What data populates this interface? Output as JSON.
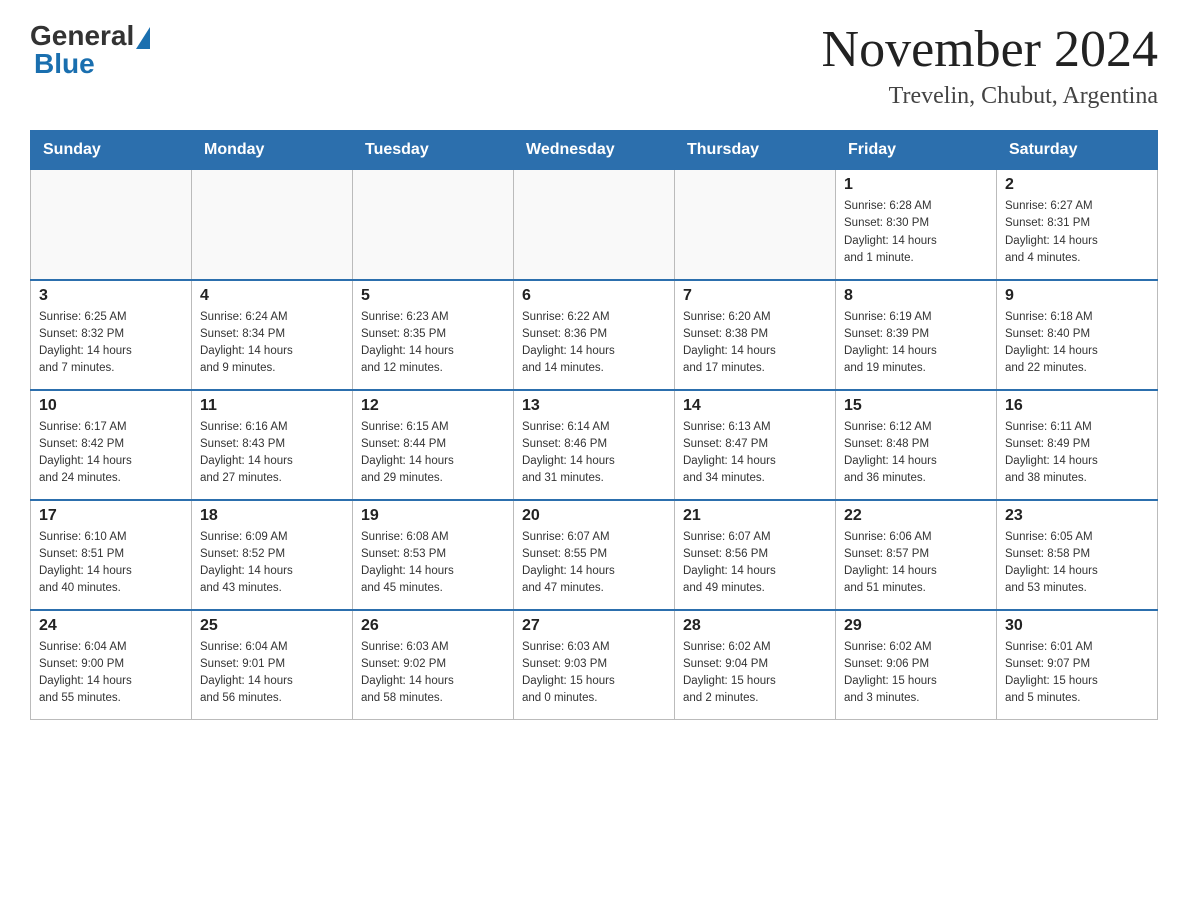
{
  "header": {
    "logo_general": "General",
    "logo_blue": "Blue",
    "month_title": "November 2024",
    "location": "Trevelin, Chubut, Argentina"
  },
  "days_of_week": [
    "Sunday",
    "Monday",
    "Tuesday",
    "Wednesday",
    "Thursday",
    "Friday",
    "Saturday"
  ],
  "weeks": [
    [
      {
        "day": "",
        "info": ""
      },
      {
        "day": "",
        "info": ""
      },
      {
        "day": "",
        "info": ""
      },
      {
        "day": "",
        "info": ""
      },
      {
        "day": "",
        "info": ""
      },
      {
        "day": "1",
        "info": "Sunrise: 6:28 AM\nSunset: 8:30 PM\nDaylight: 14 hours\nand 1 minute."
      },
      {
        "day": "2",
        "info": "Sunrise: 6:27 AM\nSunset: 8:31 PM\nDaylight: 14 hours\nand 4 minutes."
      }
    ],
    [
      {
        "day": "3",
        "info": "Sunrise: 6:25 AM\nSunset: 8:32 PM\nDaylight: 14 hours\nand 7 minutes."
      },
      {
        "day": "4",
        "info": "Sunrise: 6:24 AM\nSunset: 8:34 PM\nDaylight: 14 hours\nand 9 minutes."
      },
      {
        "day": "5",
        "info": "Sunrise: 6:23 AM\nSunset: 8:35 PM\nDaylight: 14 hours\nand 12 minutes."
      },
      {
        "day": "6",
        "info": "Sunrise: 6:22 AM\nSunset: 8:36 PM\nDaylight: 14 hours\nand 14 minutes."
      },
      {
        "day": "7",
        "info": "Sunrise: 6:20 AM\nSunset: 8:38 PM\nDaylight: 14 hours\nand 17 minutes."
      },
      {
        "day": "8",
        "info": "Sunrise: 6:19 AM\nSunset: 8:39 PM\nDaylight: 14 hours\nand 19 minutes."
      },
      {
        "day": "9",
        "info": "Sunrise: 6:18 AM\nSunset: 8:40 PM\nDaylight: 14 hours\nand 22 minutes."
      }
    ],
    [
      {
        "day": "10",
        "info": "Sunrise: 6:17 AM\nSunset: 8:42 PM\nDaylight: 14 hours\nand 24 minutes."
      },
      {
        "day": "11",
        "info": "Sunrise: 6:16 AM\nSunset: 8:43 PM\nDaylight: 14 hours\nand 27 minutes."
      },
      {
        "day": "12",
        "info": "Sunrise: 6:15 AM\nSunset: 8:44 PM\nDaylight: 14 hours\nand 29 minutes."
      },
      {
        "day": "13",
        "info": "Sunrise: 6:14 AM\nSunset: 8:46 PM\nDaylight: 14 hours\nand 31 minutes."
      },
      {
        "day": "14",
        "info": "Sunrise: 6:13 AM\nSunset: 8:47 PM\nDaylight: 14 hours\nand 34 minutes."
      },
      {
        "day": "15",
        "info": "Sunrise: 6:12 AM\nSunset: 8:48 PM\nDaylight: 14 hours\nand 36 minutes."
      },
      {
        "day": "16",
        "info": "Sunrise: 6:11 AM\nSunset: 8:49 PM\nDaylight: 14 hours\nand 38 minutes."
      }
    ],
    [
      {
        "day": "17",
        "info": "Sunrise: 6:10 AM\nSunset: 8:51 PM\nDaylight: 14 hours\nand 40 minutes."
      },
      {
        "day": "18",
        "info": "Sunrise: 6:09 AM\nSunset: 8:52 PM\nDaylight: 14 hours\nand 43 minutes."
      },
      {
        "day": "19",
        "info": "Sunrise: 6:08 AM\nSunset: 8:53 PM\nDaylight: 14 hours\nand 45 minutes."
      },
      {
        "day": "20",
        "info": "Sunrise: 6:07 AM\nSunset: 8:55 PM\nDaylight: 14 hours\nand 47 minutes."
      },
      {
        "day": "21",
        "info": "Sunrise: 6:07 AM\nSunset: 8:56 PM\nDaylight: 14 hours\nand 49 minutes."
      },
      {
        "day": "22",
        "info": "Sunrise: 6:06 AM\nSunset: 8:57 PM\nDaylight: 14 hours\nand 51 minutes."
      },
      {
        "day": "23",
        "info": "Sunrise: 6:05 AM\nSunset: 8:58 PM\nDaylight: 14 hours\nand 53 minutes."
      }
    ],
    [
      {
        "day": "24",
        "info": "Sunrise: 6:04 AM\nSunset: 9:00 PM\nDaylight: 14 hours\nand 55 minutes."
      },
      {
        "day": "25",
        "info": "Sunrise: 6:04 AM\nSunset: 9:01 PM\nDaylight: 14 hours\nand 56 minutes."
      },
      {
        "day": "26",
        "info": "Sunrise: 6:03 AM\nSunset: 9:02 PM\nDaylight: 14 hours\nand 58 minutes."
      },
      {
        "day": "27",
        "info": "Sunrise: 6:03 AM\nSunset: 9:03 PM\nDaylight: 15 hours\nand 0 minutes."
      },
      {
        "day": "28",
        "info": "Sunrise: 6:02 AM\nSunset: 9:04 PM\nDaylight: 15 hours\nand 2 minutes."
      },
      {
        "day": "29",
        "info": "Sunrise: 6:02 AM\nSunset: 9:06 PM\nDaylight: 15 hours\nand 3 minutes."
      },
      {
        "day": "30",
        "info": "Sunrise: 6:01 AM\nSunset: 9:07 PM\nDaylight: 15 hours\nand 5 minutes."
      }
    ]
  ]
}
